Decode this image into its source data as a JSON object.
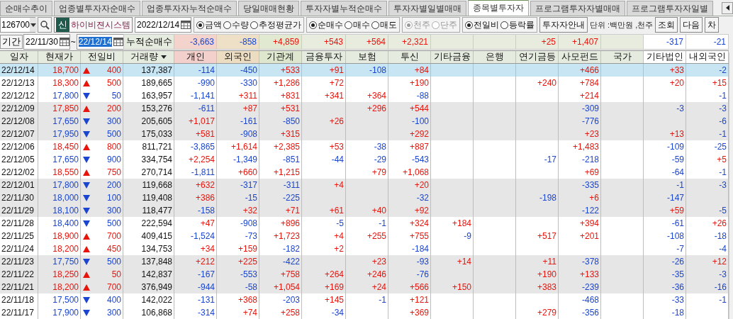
{
  "tabs": [
    {
      "label": "순매수추이",
      "selected": false
    },
    {
      "label": "업종별투자자순매수",
      "selected": false
    },
    {
      "label": "업종투자자누적순매수",
      "selected": false
    },
    {
      "label": "당일매매현황",
      "selected": false
    },
    {
      "label": "투자자별누적순매수",
      "selected": false
    },
    {
      "label": "투자자별일별매매",
      "selected": false
    },
    {
      "label": "종목별투자자",
      "selected": true
    },
    {
      "label": "프로그램투자자별매매",
      "selected": false
    },
    {
      "label": "프로그램투자자일별",
      "selected": false
    }
  ],
  "toolbar": {
    "code": "126700",
    "market_badge": "신",
    "stock_name": "하이비젼시스템",
    "date": "2022/12/14",
    "radio_groups": [
      {
        "disabled": false,
        "options": [
          {
            "label": "금액",
            "selected": true
          },
          {
            "label": "수량",
            "selected": false
          },
          {
            "label": "추정평균가",
            "selected": false
          }
        ]
      },
      {
        "disabled": false,
        "options": [
          {
            "label": "순매수",
            "selected": true
          },
          {
            "label": "매수",
            "selected": false
          },
          {
            "label": "매도",
            "selected": false
          }
        ]
      },
      {
        "disabled": true,
        "options": [
          {
            "label": "천주",
            "selected": true
          },
          {
            "label": "단주",
            "selected": false
          }
        ]
      },
      {
        "disabled": false,
        "options": [
          {
            "label": "전일비",
            "selected": true
          },
          {
            "label": "등락률",
            "selected": false
          }
        ]
      }
    ],
    "guide_button": "투자자안내",
    "unit": "단위 :백만원 ,천주",
    "buttons": [
      "조회",
      "다음",
      "차"
    ]
  },
  "period": {
    "label": "기간",
    "start": "22/11/30",
    "separator": "~",
    "end": "22/12/14",
    "end_highlighted": true,
    "summary_label": "누적순매수",
    "totals": {
      "individual": "-3,663",
      "foreign": "-858",
      "institution": "+4,859",
      "financial_investment": "+543",
      "insurance": "+564",
      "investment_trust": "+2,321",
      "pension": "+25",
      "private_fund": "+1,407",
      "other_corp": "-317",
      "domestic_foreign": "-21"
    }
  },
  "table": {
    "columns": [
      "일자",
      "현재가",
      "전일비",
      "거래량",
      "개인",
      "외국인",
      "기관계",
      "금융투자",
      "보험",
      "투신",
      "기타금융",
      "은행",
      "연기금등",
      "사모펀드",
      "국가",
      "기타법인",
      "내외국인"
    ],
    "rows": [
      {
        "date": "22/12/14",
        "price": "18,700",
        "rising": true,
        "change": "400",
        "volume": "137,387",
        "selected": true,
        "values": {
          "individual": "-114",
          "foreign": "-450",
          "institution": "+533",
          "financial_investment": "+91",
          "insurance": "-108",
          "investment_trust": "+84",
          "private_fund": "+466",
          "other_corp": "+33",
          "domestic_foreign": "-2"
        }
      },
      {
        "date": "22/12/13",
        "price": "18,300",
        "rising": true,
        "change": "500",
        "volume": "189,665",
        "selected": false,
        "values": {
          "individual": "-990",
          "foreign": "-330",
          "institution": "+1,286",
          "financial_investment": "+72",
          "investment_trust": "+190",
          "pension": "+240",
          "private_fund": "+784",
          "other_corp": "+20",
          "domestic_foreign": "+15"
        }
      },
      {
        "date": "22/12/12",
        "price": "17,800",
        "rising": false,
        "change": "50",
        "volume": "163,957",
        "selected": false,
        "values": {
          "individual": "-1,141",
          "foreign": "+311",
          "institution": "+831",
          "financial_investment": "+341",
          "insurance": "+364",
          "investment_trust": "-88",
          "private_fund": "+214",
          "domestic_foreign": "-1"
        }
      },
      {
        "date": "22/12/09",
        "price": "17,850",
        "rising": true,
        "change": "200",
        "volume": "153,276",
        "selected": false,
        "values": {
          "individual": "-611",
          "foreign": "+87",
          "institution": "+531",
          "insurance": "+296",
          "investment_trust": "+544",
          "private_fund": "-309",
          "other_corp": "-3",
          "domestic_foreign": "-3"
        }
      },
      {
        "date": "22/12/08",
        "price": "17,650",
        "rising": false,
        "change": "300",
        "volume": "205,605",
        "selected": false,
        "values": {
          "individual": "+1,017",
          "foreign": "-161",
          "institution": "-850",
          "financial_investment": "+26",
          "investment_trust": "-100",
          "private_fund": "-776",
          "domestic_foreign": "-6"
        }
      },
      {
        "date": "22/12/07",
        "price": "17,950",
        "rising": false,
        "change": "500",
        "volume": "175,033",
        "selected": false,
        "values": {
          "individual": "+581",
          "foreign": "-908",
          "institution": "+315",
          "investment_trust": "+292",
          "private_fund": "+23",
          "other_corp": "+13",
          "domestic_foreign": "-1"
        }
      },
      {
        "date": "22/12/06",
        "price": "18,450",
        "rising": true,
        "change": "800",
        "volume": "811,721",
        "selected": false,
        "values": {
          "individual": "-3,865",
          "foreign": "+1,614",
          "institution": "+2,385",
          "financial_investment": "+53",
          "insurance": "-38",
          "investment_trust": "+887",
          "private_fund": "+1,483",
          "other_corp": "-109",
          "domestic_foreign": "-25"
        }
      },
      {
        "date": "22/12/05",
        "price": "17,650",
        "rising": false,
        "change": "900",
        "volume": "334,754",
        "selected": false,
        "values": {
          "individual": "+2,254",
          "foreign": "-1,349",
          "institution": "-851",
          "financial_investment": "-44",
          "insurance": "-29",
          "investment_trust": "-543",
          "pension": "-17",
          "private_fund": "-218",
          "other_corp": "-59",
          "domestic_foreign": "+5"
        }
      },
      {
        "date": "22/12/02",
        "price": "18,550",
        "rising": true,
        "change": "750",
        "volume": "270,714",
        "selected": false,
        "values": {
          "individual": "-1,811",
          "foreign": "+660",
          "institution": "+1,215",
          "insurance": "+79",
          "investment_trust": "+1,068",
          "private_fund": "+69",
          "other_corp": "-64",
          "domestic_foreign": "-1"
        }
      },
      {
        "date": "22/12/01",
        "price": "17,800",
        "rising": false,
        "change": "200",
        "volume": "119,668",
        "selected": false,
        "values": {
          "individual": "+632",
          "foreign": "-317",
          "institution": "-311",
          "financial_investment": "+4",
          "investment_trust": "+20",
          "private_fund": "-335",
          "other_corp": "-1",
          "domestic_foreign": "-3"
        }
      },
      {
        "date": "22/11/30",
        "price": "18,000",
        "rising": false,
        "change": "100",
        "volume": "119,408",
        "selected": false,
        "values": {
          "individual": "+386",
          "foreign": "-15",
          "institution": "-225",
          "investment_trust": "-32",
          "pension": "-198",
          "private_fund": "+6",
          "other_corp": "-147"
        }
      },
      {
        "date": "22/11/29",
        "price": "18,100",
        "rising": false,
        "change": "300",
        "volume": "118,477",
        "selected": false,
        "values": {
          "individual": "-158",
          "foreign": "+32",
          "institution": "+71",
          "financial_investment": "+61",
          "insurance": "+40",
          "investment_trust": "+92",
          "private_fund": "-122",
          "other_corp": "+59",
          "domestic_foreign": "-5"
        }
      },
      {
        "date": "22/11/28",
        "price": "18,400",
        "rising": false,
        "change": "500",
        "volume": "222,594",
        "selected": false,
        "values": {
          "individual": "+47",
          "foreign": "-908",
          "institution": "+896",
          "financial_investment": "-5",
          "insurance": "-1",
          "investment_trust": "+324",
          "other_finance": "+184",
          "private_fund": "+394",
          "other_corp": "-61",
          "domestic_foreign": "+26"
        }
      },
      {
        "date": "22/11/25",
        "price": "18,900",
        "rising": true,
        "change": "700",
        "volume": "409,415",
        "selected": false,
        "values": {
          "individual": "-1,524",
          "foreign": "-73",
          "institution": "+1,723",
          "financial_investment": "+4",
          "insurance": "+255",
          "investment_trust": "+755",
          "other_finance": "-9",
          "pension": "+517",
          "private_fund": "+201",
          "other_corp": "-108",
          "domestic_foreign": "-18"
        }
      },
      {
        "date": "22/11/24",
        "price": "18,200",
        "rising": true,
        "change": "450",
        "volume": "134,753",
        "selected": false,
        "values": {
          "individual": "+34",
          "foreign": "+159",
          "institution": "-182",
          "financial_investment": "+2",
          "investment_trust": "-184",
          "other_corp": "-7",
          "domestic_foreign": "-4"
        }
      },
      {
        "date": "22/11/23",
        "price": "17,750",
        "rising": false,
        "change": "500",
        "volume": "137,848",
        "selected": false,
        "values": {
          "individual": "+212",
          "foreign": "+225",
          "institution": "-422",
          "insurance": "+23",
          "investment_trust": "-93",
          "other_finance": "+14",
          "pension": "+11",
          "private_fund": "-378",
          "other_corp": "-26",
          "domestic_foreign": "+12"
        }
      },
      {
        "date": "22/11/22",
        "price": "18,250",
        "rising": true,
        "change": "50",
        "volume": "142,837",
        "selected": false,
        "values": {
          "individual": "-167",
          "foreign": "-553",
          "institution": "+758",
          "financial_investment": "+264",
          "insurance": "+246",
          "investment_trust": "-76",
          "pension": "+190",
          "private_fund": "+133",
          "other_corp": "-35",
          "domestic_foreign": "-3"
        }
      },
      {
        "date": "22/11/21",
        "price": "18,200",
        "rising": true,
        "change": "700",
        "volume": "376,949",
        "selected": false,
        "values": {
          "individual": "-944",
          "foreign": "-58",
          "institution": "+1,054",
          "financial_investment": "+169",
          "insurance": "+24",
          "investment_trust": "+566",
          "other_finance": "+150",
          "pension": "+383",
          "private_fund": "-239",
          "other_corp": "-36",
          "domestic_foreign": "-16"
        }
      },
      {
        "date": "22/11/18",
        "price": "17,500",
        "rising": false,
        "change": "400",
        "volume": "142,022",
        "selected": false,
        "values": {
          "individual": "-131",
          "foreign": "+368",
          "institution": "-203",
          "financial_investment": "+145",
          "insurance": "-1",
          "investment_trust": "+121",
          "private_fund": "-468",
          "other_corp": "-33",
          "domestic_foreign": "-1"
        }
      },
      {
        "date": "22/11/17",
        "price": "17,900",
        "rising": false,
        "change": "300",
        "volume": "106,868",
        "selected": false,
        "values": {
          "individual": "-314",
          "foreign": "+74",
          "institution": "+258",
          "financial_investment": "-34",
          "investment_trust": "+369",
          "pension": "+279",
          "private_fund": "-356",
          "other_corp": "-18"
        }
      }
    ]
  }
}
